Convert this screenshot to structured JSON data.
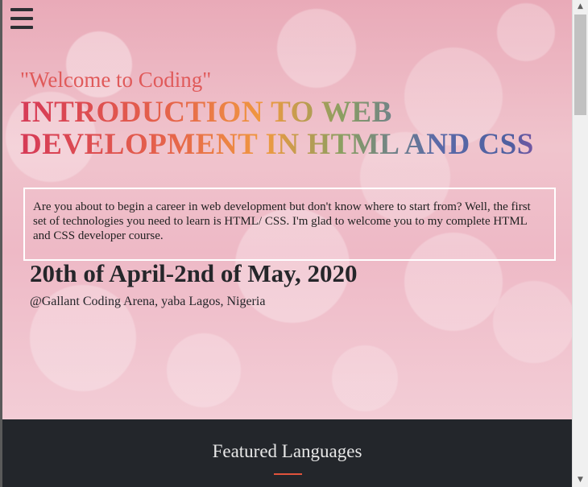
{
  "nav": {
    "menu_icon": "hamburger-menu-icon"
  },
  "hero": {
    "welcome": "\"Welcome to Coding\"",
    "title": "INTRODUCTION TO WEB DEVELOPMENT IN HTML AND CSS",
    "intro": "Are you about to begin a career in web development but don't know where to start from? Well, the first set of technologies you need to learn is HTML/ CSS. I'm glad to welcome you to my complete HTML and CSS developer course.",
    "dates": "20th of April-2nd of May, 2020",
    "venue": "@Gallant Coding Arena, yaba Lagos, Nigeria"
  },
  "featured": {
    "title": "Featured Languages",
    "accent_color": "#e0533c"
  },
  "scrollbar": {
    "up_icon": "triangle-up-icon",
    "down_icon": "triangle-down-icon"
  },
  "colors": {
    "dark_section": "#23262b",
    "welcome_text": "#e05a5a"
  }
}
